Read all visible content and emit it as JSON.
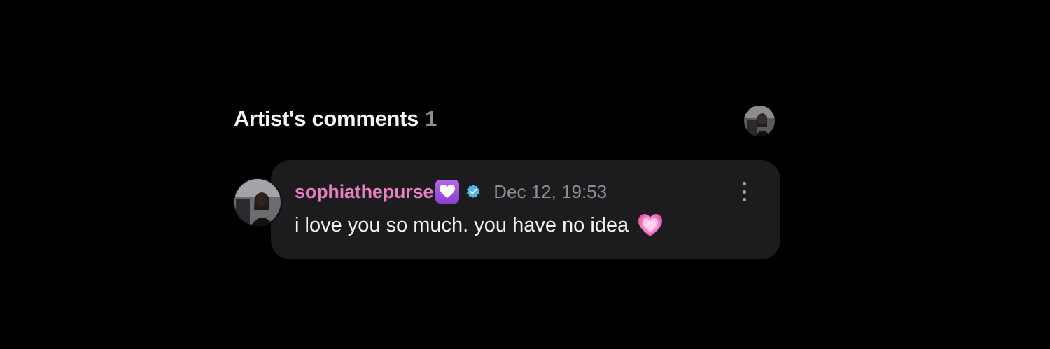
{
  "section": {
    "title": "Artist's comments",
    "count": "1"
  },
  "comment": {
    "username": "sophiathepurse",
    "timestamp": "Dec 12, 19:53",
    "text": "i love you so much. you have no idea",
    "verified": true,
    "username_color": "#e77fc3",
    "badge_icon": "purple-heart-badge-icon",
    "trailing_icon": "pink-heart-icon"
  },
  "colors": {
    "background": "#000000",
    "card": "#1c1c1e",
    "verified": "#4fb6e8",
    "muted": "#8e8e93"
  }
}
